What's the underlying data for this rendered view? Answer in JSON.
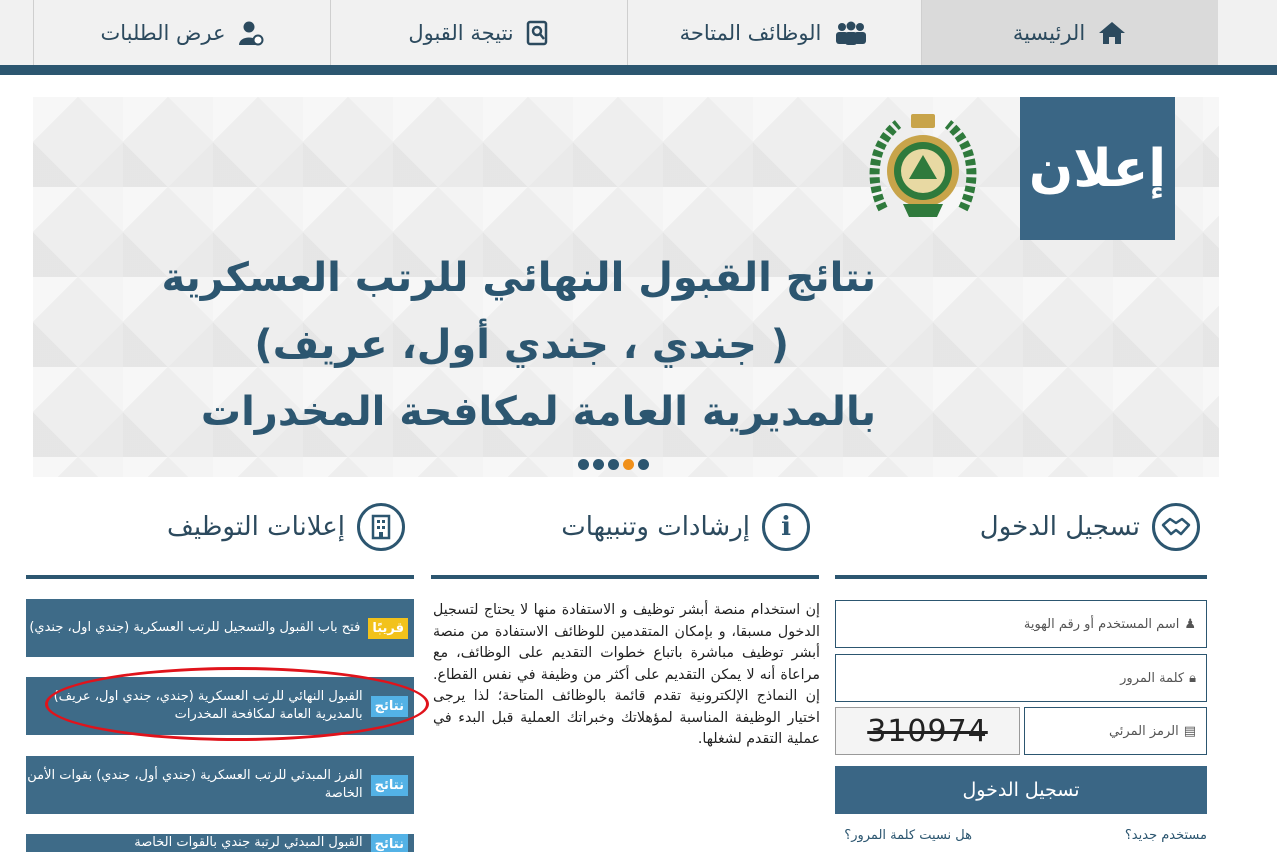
{
  "nav": [
    {
      "label": "الرئيسية",
      "icon": "home-icon",
      "active": true
    },
    {
      "label": "الوظائف المتاحة",
      "icon": "people-icon",
      "active": false
    },
    {
      "label": "نتيجة القبول",
      "icon": "search-document-icon",
      "active": false
    },
    {
      "label": "عرض الطلبات",
      "icon": "user-settings-icon",
      "active": false
    }
  ],
  "banner": {
    "badge": "إعلان",
    "line1": "نتائج القبول النهائي للرتب العسكرية",
    "line2": "( جندي ، جندي أول، عريف)",
    "line3": "بالمديرية العامة لمكافحة المخدرات",
    "active_slide": 4,
    "slide_count": 5
  },
  "login": {
    "title": "تسجيل الدخول",
    "username_placeholder": "اسم المستخدم أو رقم الهوية",
    "password_placeholder": "كلمة المرور",
    "captcha_placeholder": "الرمز المرئي",
    "captcha_text": "310974",
    "submit": "تسجيل الدخول",
    "new_user": "مستخدم جديد؟",
    "forgot": "هل نسيت كلمة المرور؟"
  },
  "guide": {
    "title": "إرشادات وتنبيهات",
    "text": "إن استخدام منصة أبشر توظيف و الاستفادة منها لا يحتاج لتسجيل الدخول مسبقا، و بإمكان المتقدمين للوظائف الاستفادة من منصة أبشر توظيف مباشرة باتباع خطوات التقديم على الوظائف، مع مراعاة أنه لا يمكن التقديم على أكثر من وظيفة في نفس القطاع. إن النماذج الإلكترونية تقدم قائمة بالوظائف المتاحة؛ لذا يرجى اختيار الوظيفة المناسبة لمؤهلاتك وخبراتك العملية قبل البدء في عملية التقدم لشغلها."
  },
  "news": {
    "title": "إعلانات التوظيف",
    "items": [
      {
        "badge": "قريبًا",
        "text": "فتح باب القبول والتسجيل للرتب العسكرية (جندي اول، جندي)"
      },
      {
        "badge": "نتائج",
        "text": "القبول النهائي للرتب العسكرية (جندي، جندي اول، عريف) بالمديرية العامة لمكافحة المخدرات"
      },
      {
        "badge": "نتائج",
        "text": "الفرز المبدئي للرتب العسكرية (جندي أول، جندي) بقوات الأمن الخاصة"
      },
      {
        "badge": "نتائج",
        "text": "القبول المبدئي لرتبة جندي بالقوات الخاصة"
      }
    ]
  }
}
